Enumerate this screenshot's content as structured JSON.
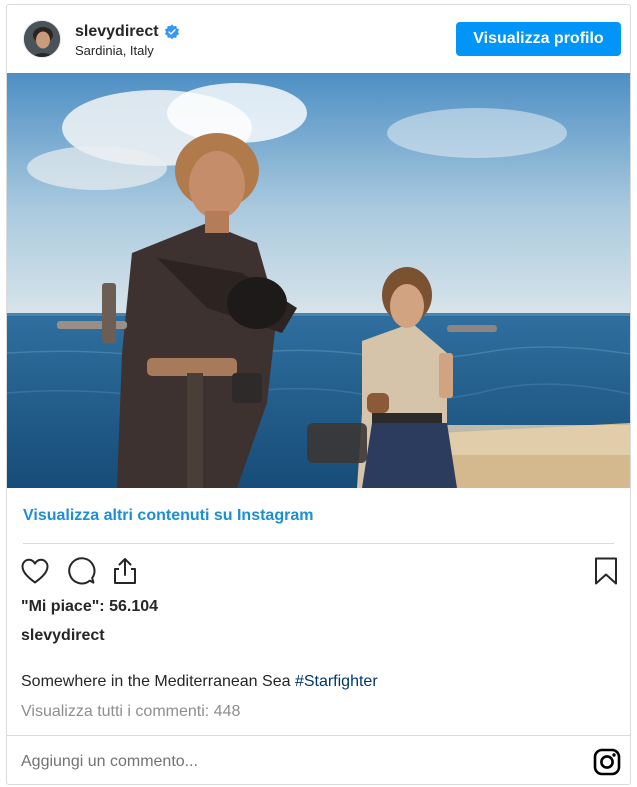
{
  "header": {
    "username": "slevydirect",
    "location": "Sardinia, Italy",
    "view_profile_label": "Visualizza profilo"
  },
  "post": {
    "more_link": "Visualizza altri contenuti su Instagram",
    "likes": "\"Mi piace\": 56.104",
    "caption_author": "slevydirect",
    "caption_text": "Somewhere in the Mediterranean Sea ",
    "caption_hashtag": "#Starfighter",
    "view_comments": "Visualizza tutti i commenti: 448"
  },
  "comment_input": {
    "placeholder": "Aggiungi un commento..."
  },
  "icons": {
    "verified": "verified-badge-icon",
    "like": "heart-icon",
    "comment": "comment-bubble-icon",
    "share": "share-icon",
    "save": "bookmark-icon",
    "instagram": "instagram-logo-icon"
  },
  "colors": {
    "primary_button": "#0095f6",
    "link": "#1b8fd6",
    "hashtag": "#00376b",
    "muted": "#8e8e8e"
  }
}
